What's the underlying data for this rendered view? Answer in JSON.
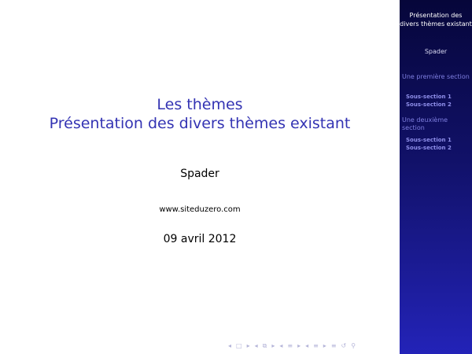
{
  "slide": {
    "title_line1": "Les thèmes",
    "title_line2": "Présentation des divers thèmes existant",
    "author": "Spader",
    "institute": "www.siteduzero.com",
    "date": "09 avril 2012"
  },
  "sidebar": {
    "title": "Présentation des divers thèmes existant",
    "author": "Spader",
    "sections": [
      {
        "label": "Une première section",
        "subsections": [
          "Sous-section 1",
          "Sous-section 2"
        ]
      },
      {
        "label": "Une deuxième section",
        "subsections": [
          "Sous-section 1",
          "Sous-section 2"
        ]
      }
    ]
  },
  "navigation": {
    "icons": [
      "prev-slide-icon",
      "slide-icon",
      "next-slide-icon",
      "prev-frame-icon",
      "frame-icon",
      "next-frame-icon",
      "prev-subsection-icon",
      "subsection-icon",
      "next-subsection-icon",
      "prev-section-icon",
      "section-icon",
      "next-section-icon",
      "toc-icon",
      "undo-icon",
      "zoom-icon"
    ],
    "color": "#b5b5d9"
  },
  "colors": {
    "title": "#3333b3",
    "sidebar_top": "#06063a",
    "sidebar_bottom": "#2323b8"
  }
}
